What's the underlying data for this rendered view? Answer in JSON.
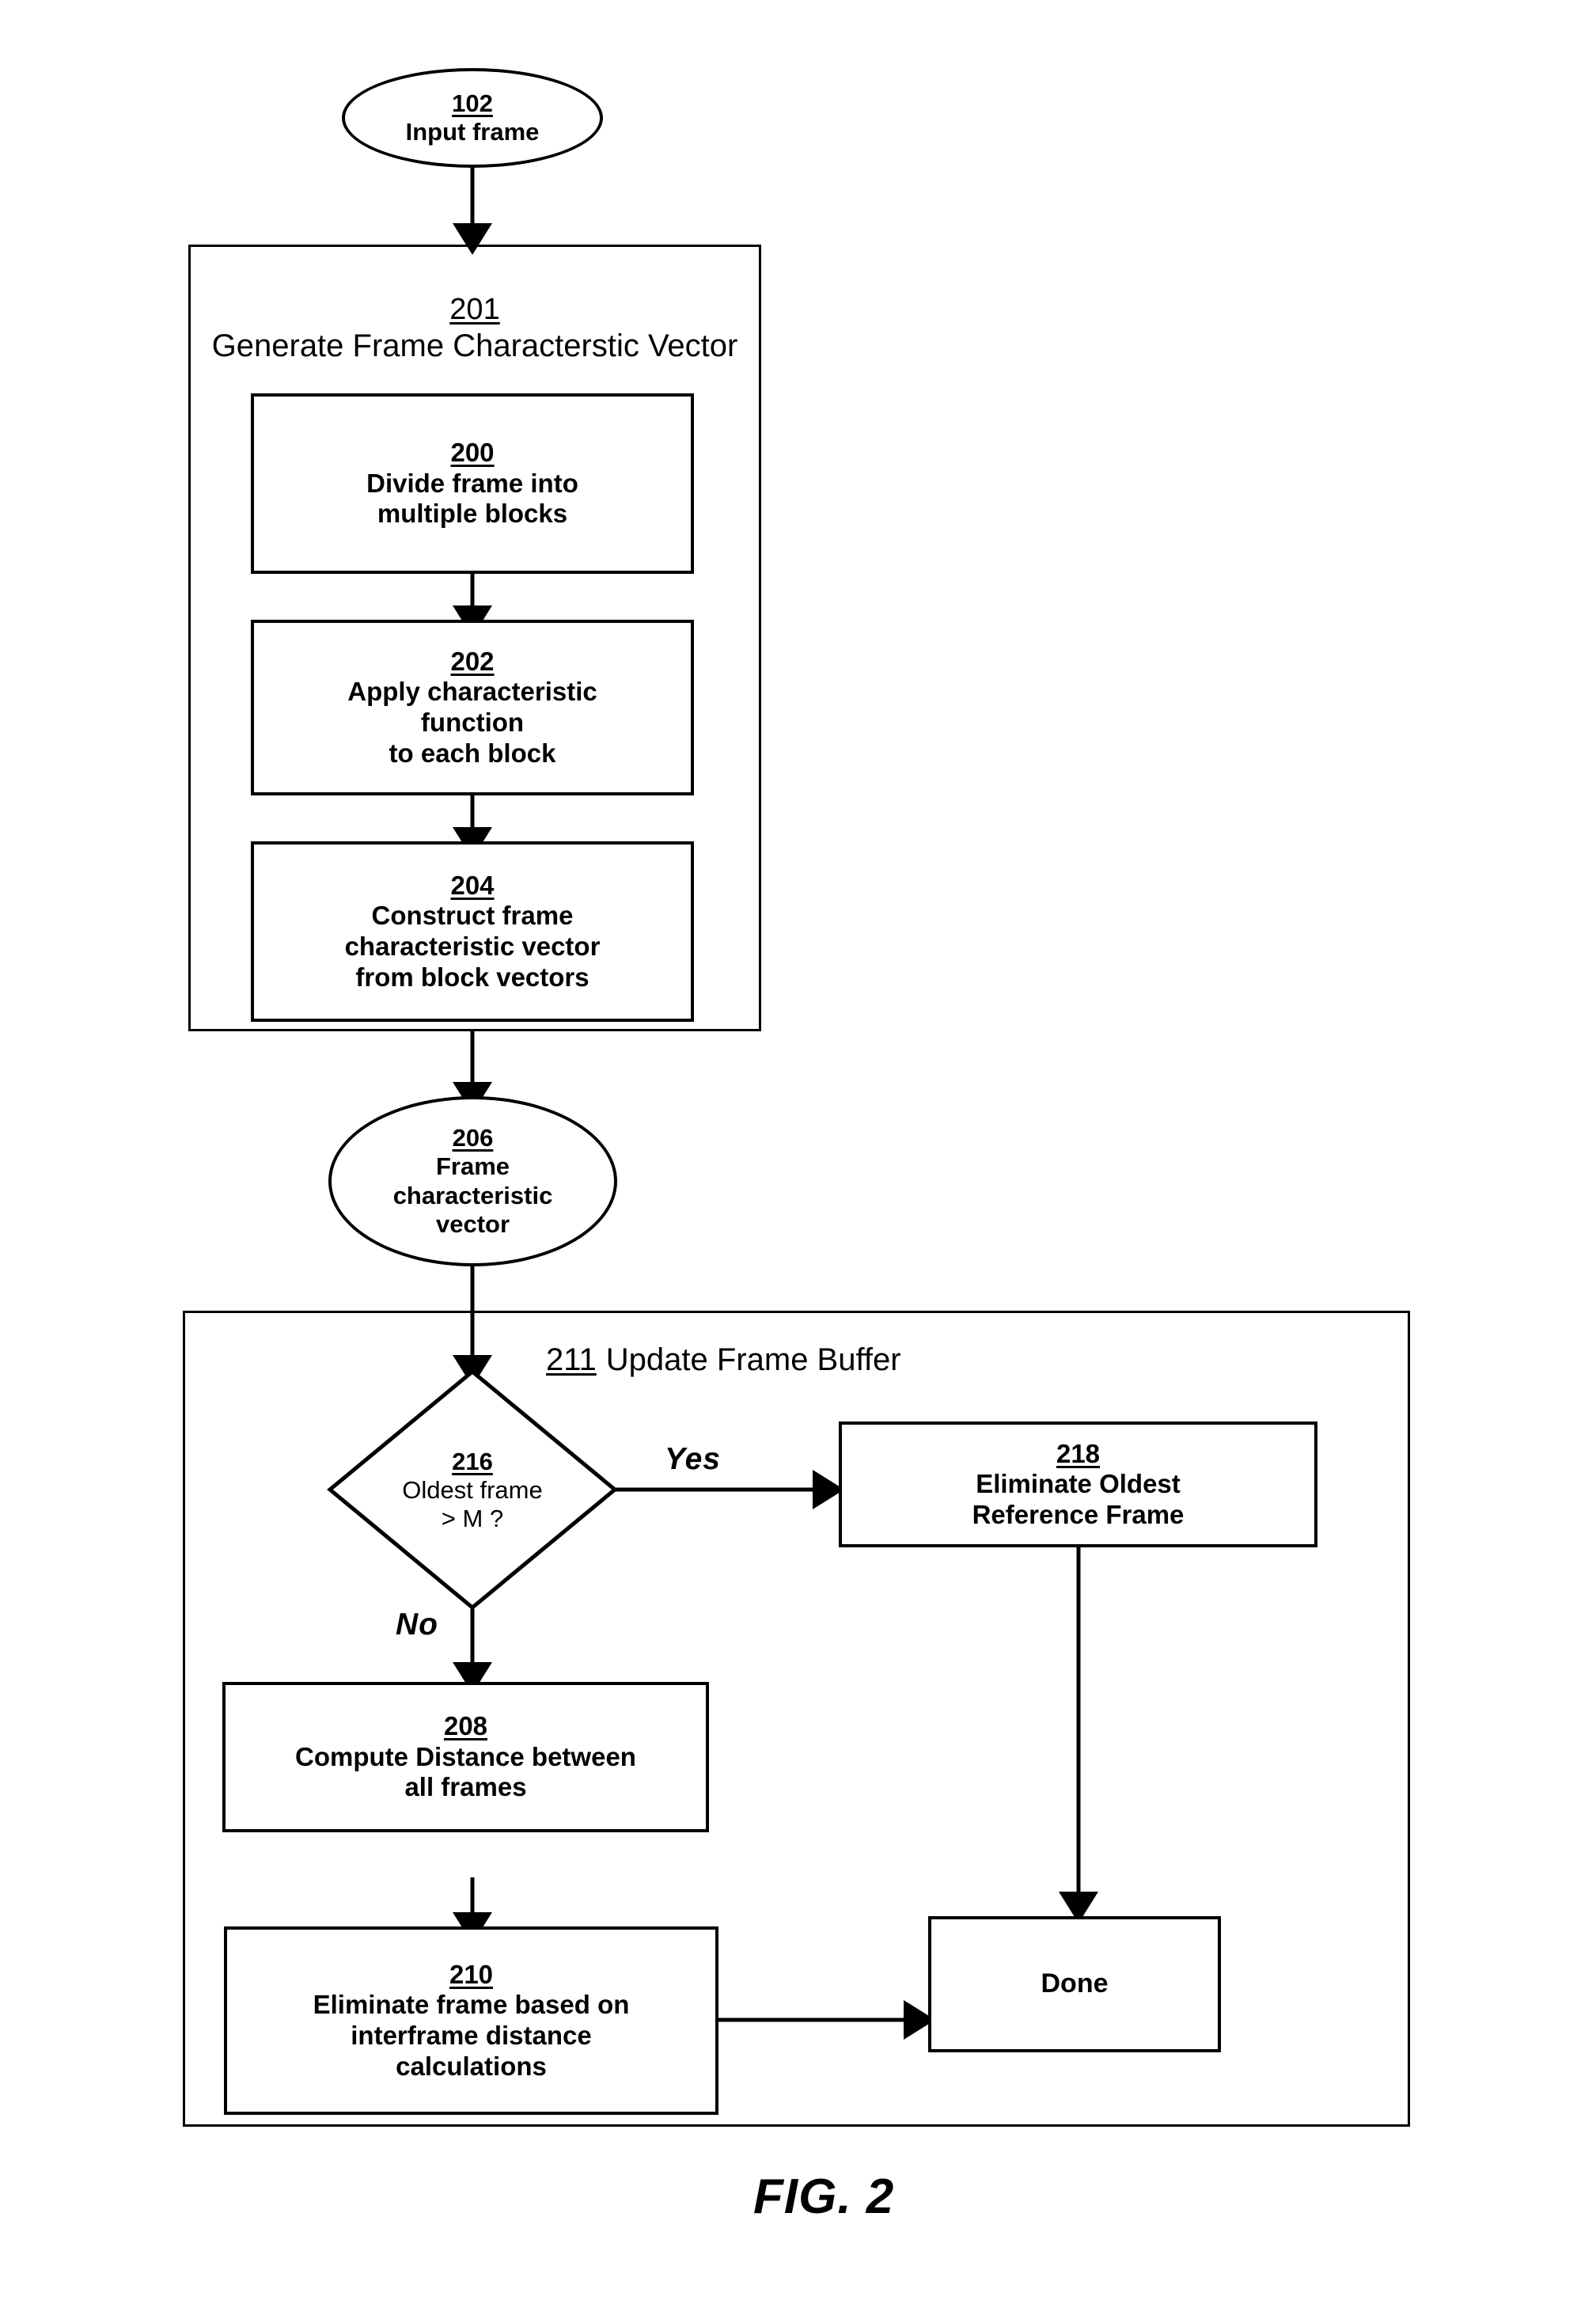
{
  "figure": {
    "label": "FIG. 2",
    "title_note": "Patent flowchart figure"
  },
  "nodes": {
    "input_frame": {
      "ref": "102",
      "text": "Input frame",
      "shape": "ellipse"
    },
    "generate_fcv": {
      "ref": "201",
      "text": "Generate Frame Characterstic Vector",
      "shape": "container"
    },
    "divide_frame": {
      "ref": "200",
      "line1": "Divide frame into",
      "line2": "multiple blocks",
      "shape": "rect"
    },
    "apply_function": {
      "ref": "202",
      "line1": "Apply characteristic",
      "line2": "function",
      "line3": "to each block",
      "shape": "rect"
    },
    "construct_vector": {
      "ref": "204",
      "line1": "Construct frame",
      "line2": "characteristic vector",
      "line3": "from block vectors",
      "shape": "rect"
    },
    "frame_char_vector": {
      "ref": "206",
      "line1": "Frame",
      "line2": "characteristic",
      "line3": "vector",
      "shape": "ellipse"
    },
    "update_frame_buffer": {
      "ref": "211",
      "text": "Update Frame Buffer",
      "shape": "container"
    },
    "oldest_frame_decision": {
      "ref": "216",
      "line1": "Oldest frame",
      "line2": "> M ?",
      "shape": "diamond"
    },
    "eliminate_oldest_reference": {
      "ref": "218",
      "line1": "Eliminate Oldest",
      "line2": "Reference Frame",
      "shape": "rect"
    },
    "compute_distance": {
      "ref": "208",
      "line1": "Compute Distance between",
      "line2": "all frames",
      "shape": "rect"
    },
    "eliminate_frame": {
      "ref": "210",
      "line1": "Eliminate frame based on",
      "line2": "interframe distance",
      "line3": "calculations",
      "shape": "rect"
    },
    "done": {
      "text": "Done",
      "shape": "rect"
    }
  },
  "edge_labels": {
    "yes": "Yes",
    "no": "No"
  },
  "colors": {
    "stroke": "#000000",
    "background": "#ffffff",
    "text": "#000000"
  }
}
